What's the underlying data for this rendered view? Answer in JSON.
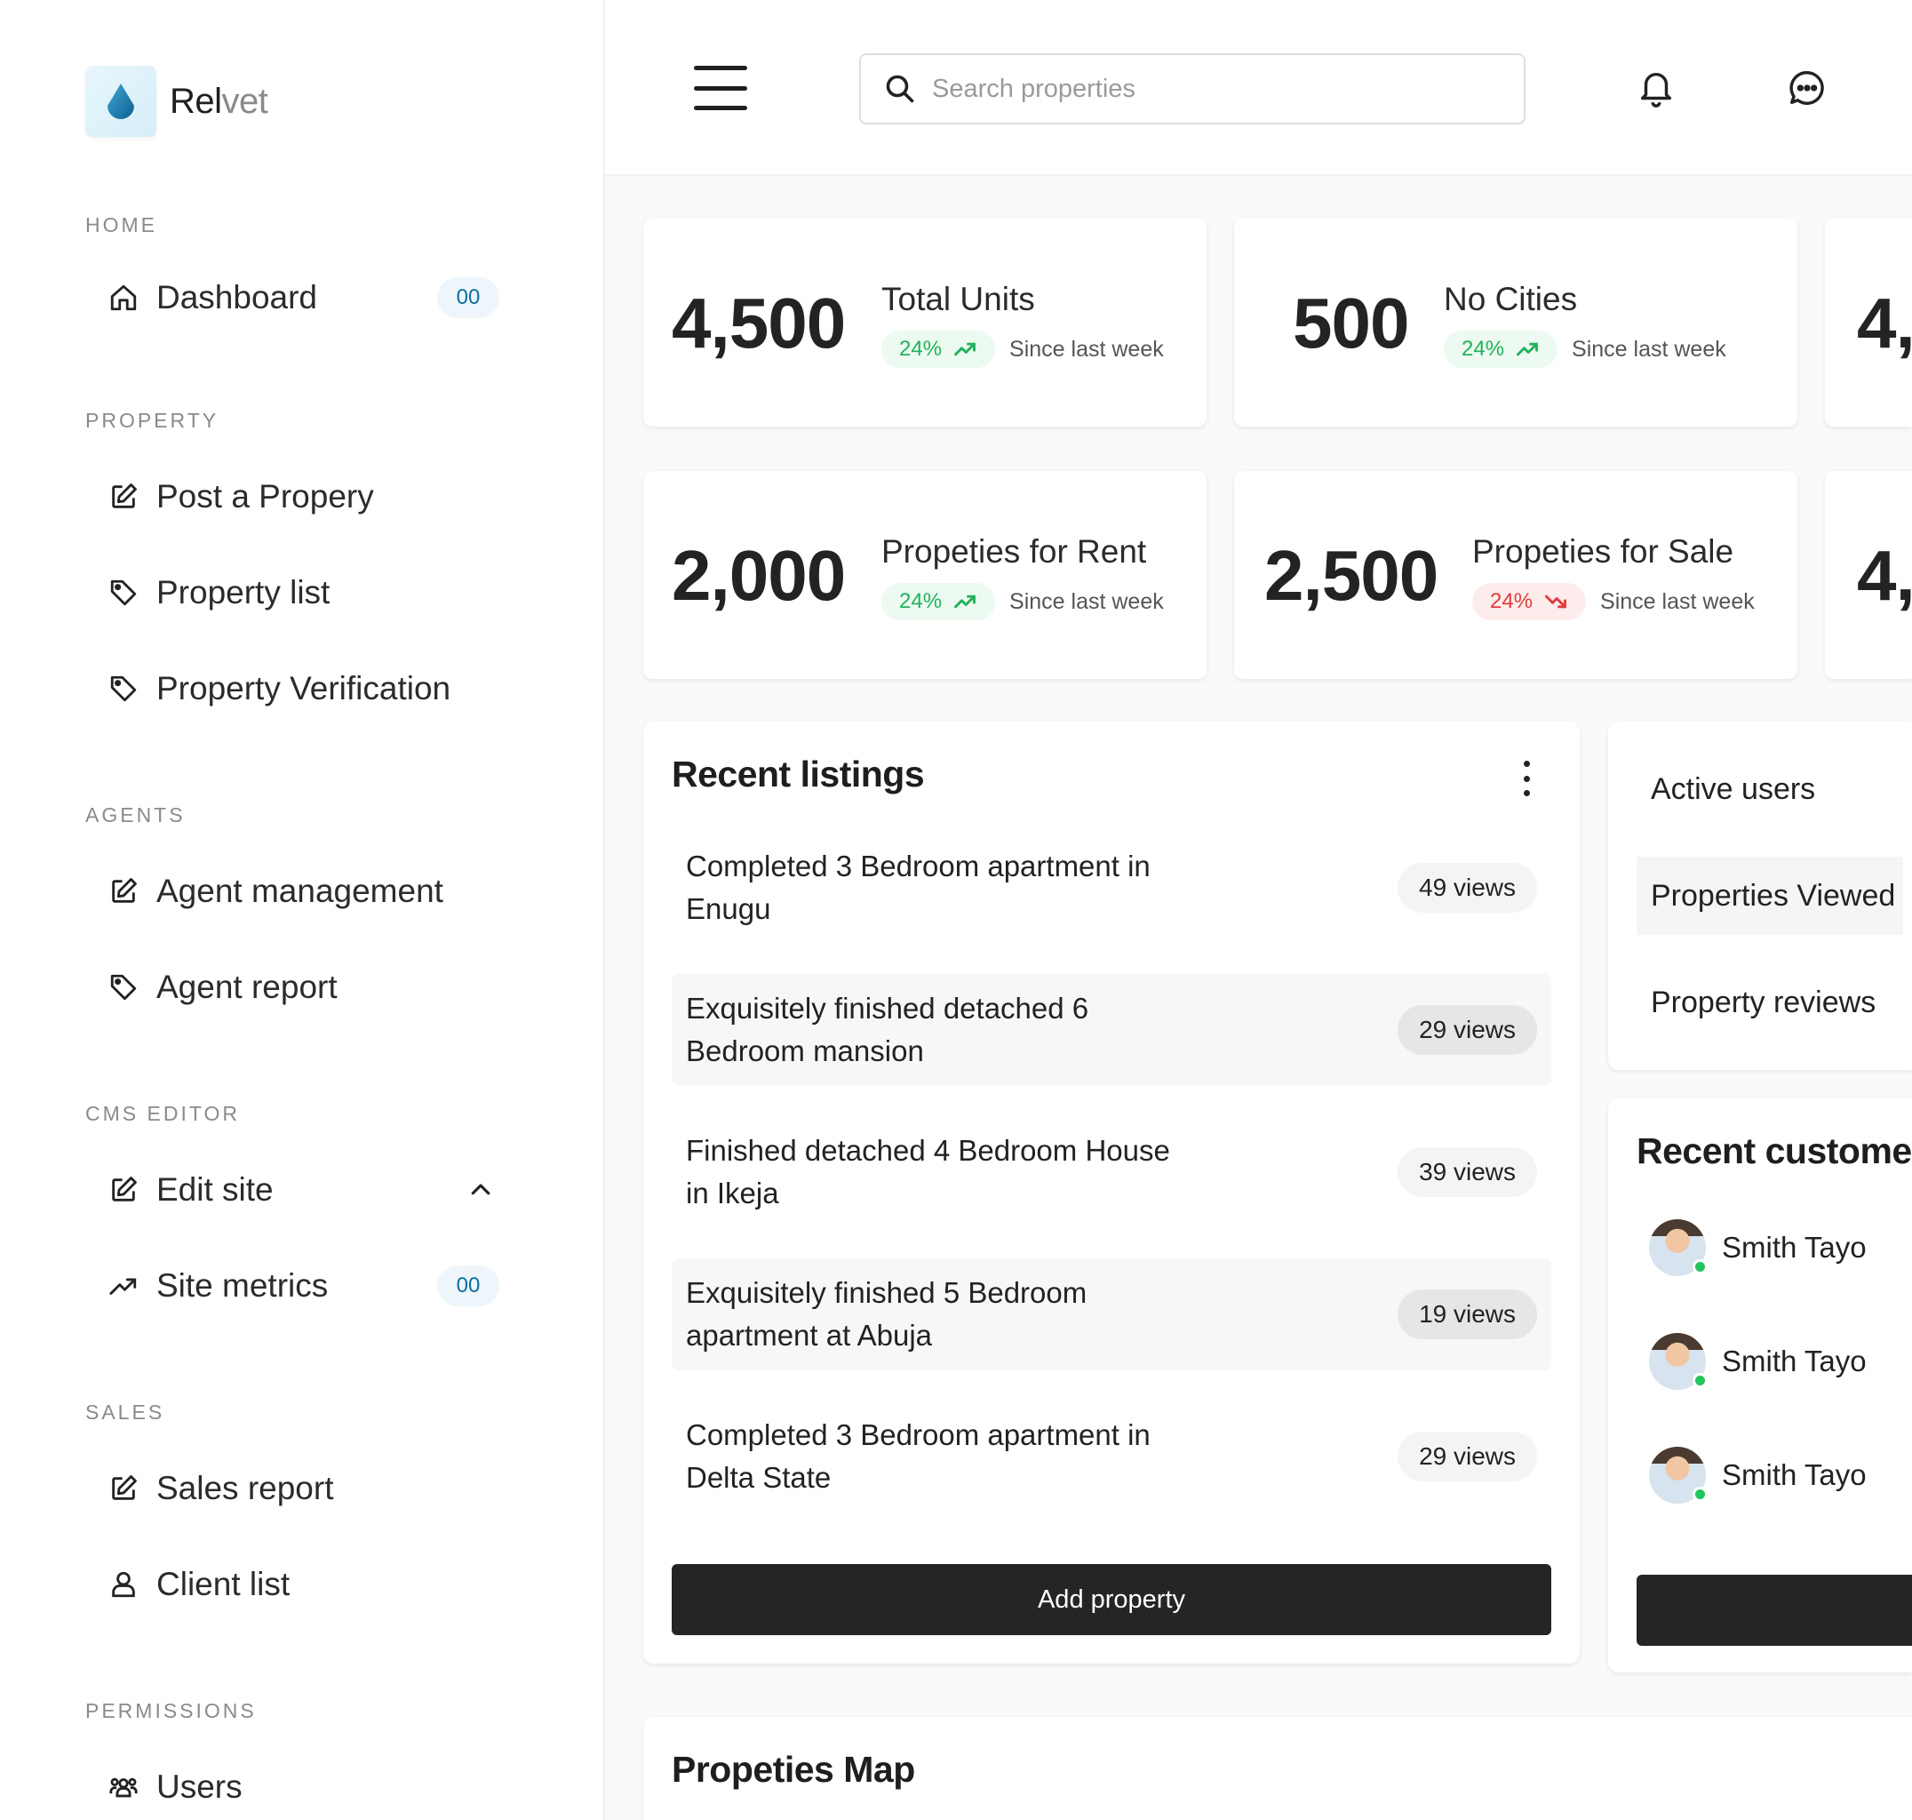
{
  "brand": {
    "name_bold": "Rel",
    "name_light": "vet"
  },
  "sidebar": {
    "sections": [
      {
        "label": "HOME",
        "items": [
          {
            "label": "Dashboard",
            "badge": "00"
          }
        ]
      },
      {
        "label": "PROPERTY",
        "items": [
          {
            "label": "Post a Propery"
          },
          {
            "label": "Property list"
          },
          {
            "label": "Property Verification"
          }
        ]
      },
      {
        "label": "AGENTS",
        "items": [
          {
            "label": "Agent management"
          },
          {
            "label": "Agent report"
          }
        ]
      },
      {
        "label": "CMS EDITOR",
        "items": [
          {
            "label": "Edit site"
          },
          {
            "label": "Site metrics",
            "badge": "00"
          }
        ]
      },
      {
        "label": "SALES",
        "items": [
          {
            "label": "Sales report"
          },
          {
            "label": "Client list"
          }
        ]
      },
      {
        "label": "PERMISSIONS",
        "items": [
          {
            "label": "Users"
          }
        ]
      }
    ]
  },
  "search": {
    "placeholder": "Search properties"
  },
  "stats": [
    {
      "value": "4,500",
      "title": "Total Units",
      "change": "24%",
      "trend": "up",
      "since": "Since last week"
    },
    {
      "value": "500",
      "title": "No Cities",
      "change": "24%",
      "trend": "up",
      "since": "Since last week"
    },
    {
      "value": "4,",
      "title": "",
      "change": "",
      "trend": "up",
      "since": ""
    },
    {
      "value": "2,000",
      "title": "Propeties for Rent",
      "change": "24%",
      "trend": "up",
      "since": "Since last week"
    },
    {
      "value": "2,500",
      "title": "Propeties for Sale",
      "change": "24%",
      "trend": "down",
      "since": "Since last week"
    },
    {
      "value": "4,",
      "title": "",
      "change": "",
      "trend": "up",
      "since": ""
    }
  ],
  "listings": {
    "title": "Recent listings",
    "items": [
      {
        "title": "Completed 3 Bedroom apartment in Enugu",
        "views": "49 views"
      },
      {
        "title": "Exquisitely finished detached 6 Bedroom mansion",
        "views": "29 views"
      },
      {
        "title": "Finished detached 4 Bedroom House in Ikeja",
        "views": "39 views"
      },
      {
        "title": "Exquisitely finished 5 Bedroom apartment at Abuja",
        "views": "19 views"
      },
      {
        "title": "Completed 3 Bedroom apartment in Delta State",
        "views": "29 views"
      }
    ],
    "button": "Add property"
  },
  "activity": {
    "links": [
      "Active users",
      "Properties Viewed",
      "Property reviews"
    ]
  },
  "customers": {
    "title": "Recent customers",
    "items": [
      {
        "name": "Smith Tayo"
      },
      {
        "name": "Smith Tayo"
      },
      {
        "name": "Smith Tayo"
      }
    ]
  },
  "map": {
    "title": "Propeties Map"
  },
  "colors": {
    "accent": "#0b6ea3",
    "up": "#22b25b",
    "down": "#e03b3b",
    "button": "#252525"
  }
}
